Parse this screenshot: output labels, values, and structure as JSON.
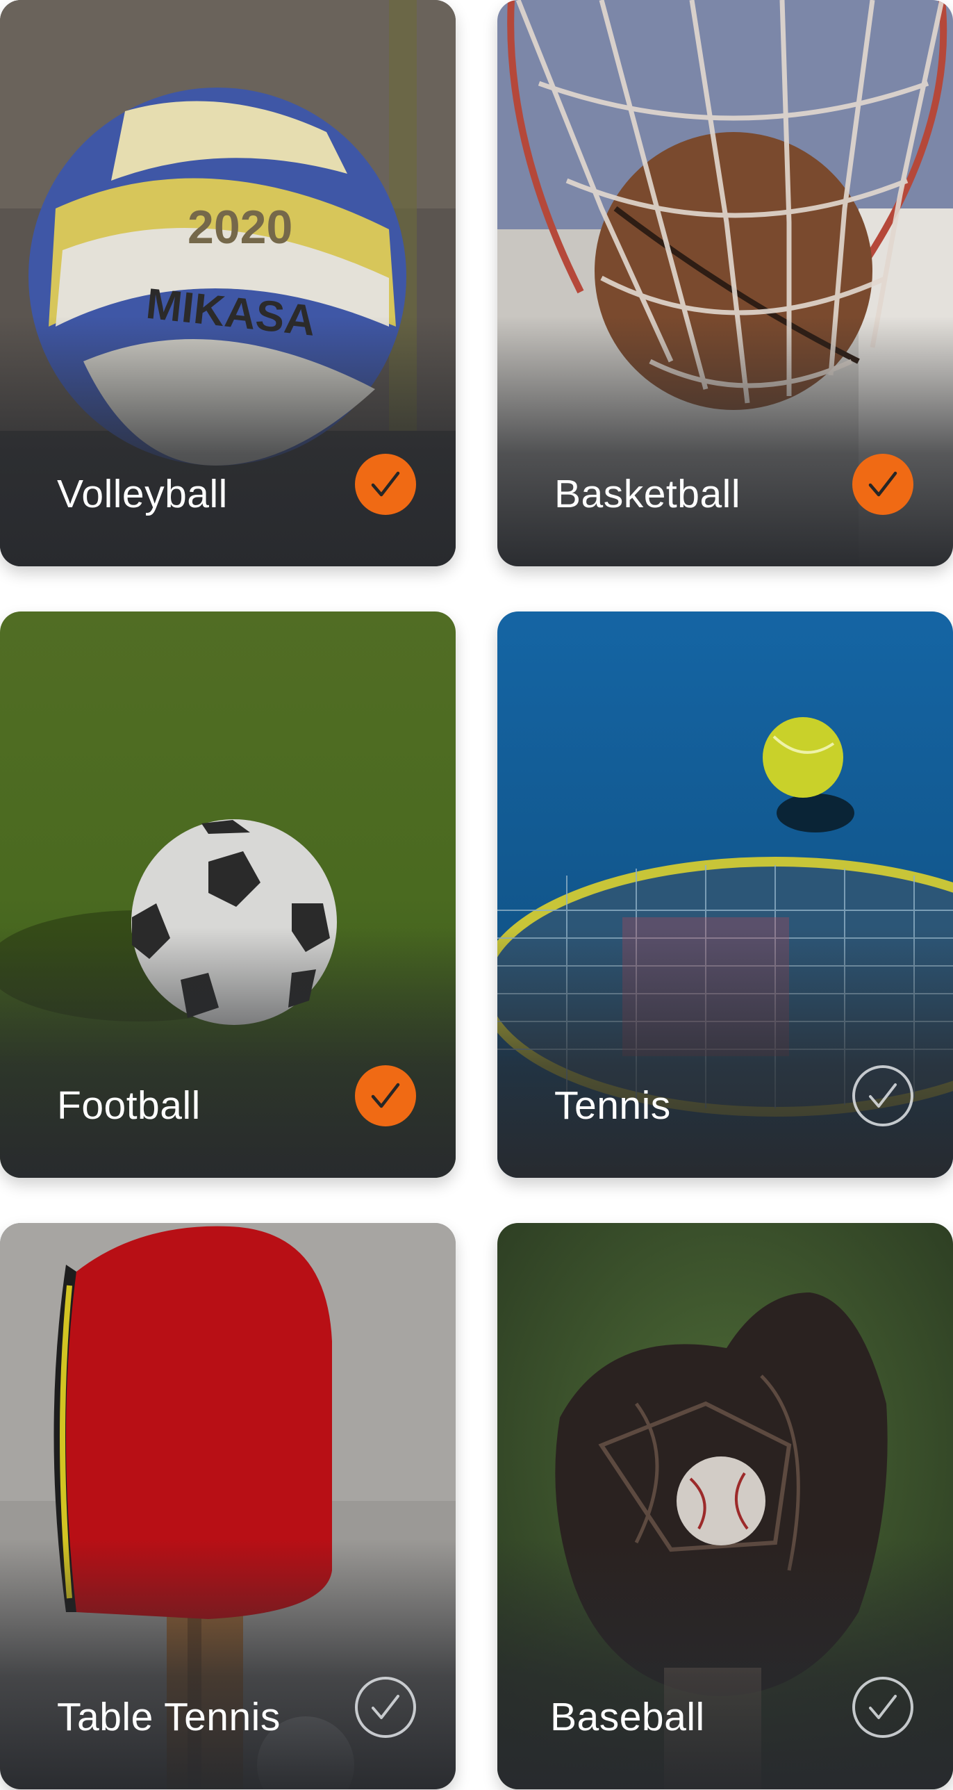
{
  "sports": [
    {
      "name": "Volleyball",
      "selected": true,
      "icon": "check-icon"
    },
    {
      "name": "Basketball",
      "selected": true,
      "icon": "check-icon"
    },
    {
      "name": "Football",
      "selected": true,
      "icon": "check-icon"
    },
    {
      "name": "Tennis",
      "selected": false,
      "icon": "check-icon"
    },
    {
      "name": "Table Tennis",
      "selected": false,
      "icon": "check-icon"
    },
    {
      "name": "Baseball",
      "selected": false,
      "icon": "check-icon"
    }
  ],
  "ball_text": {
    "volleyball_year": "2020",
    "volleyball_brand": "MIKASA"
  },
  "colors": {
    "accent": "#f06a14",
    "unselected_ring": "#e1e4e8",
    "label": "#ffffff"
  }
}
